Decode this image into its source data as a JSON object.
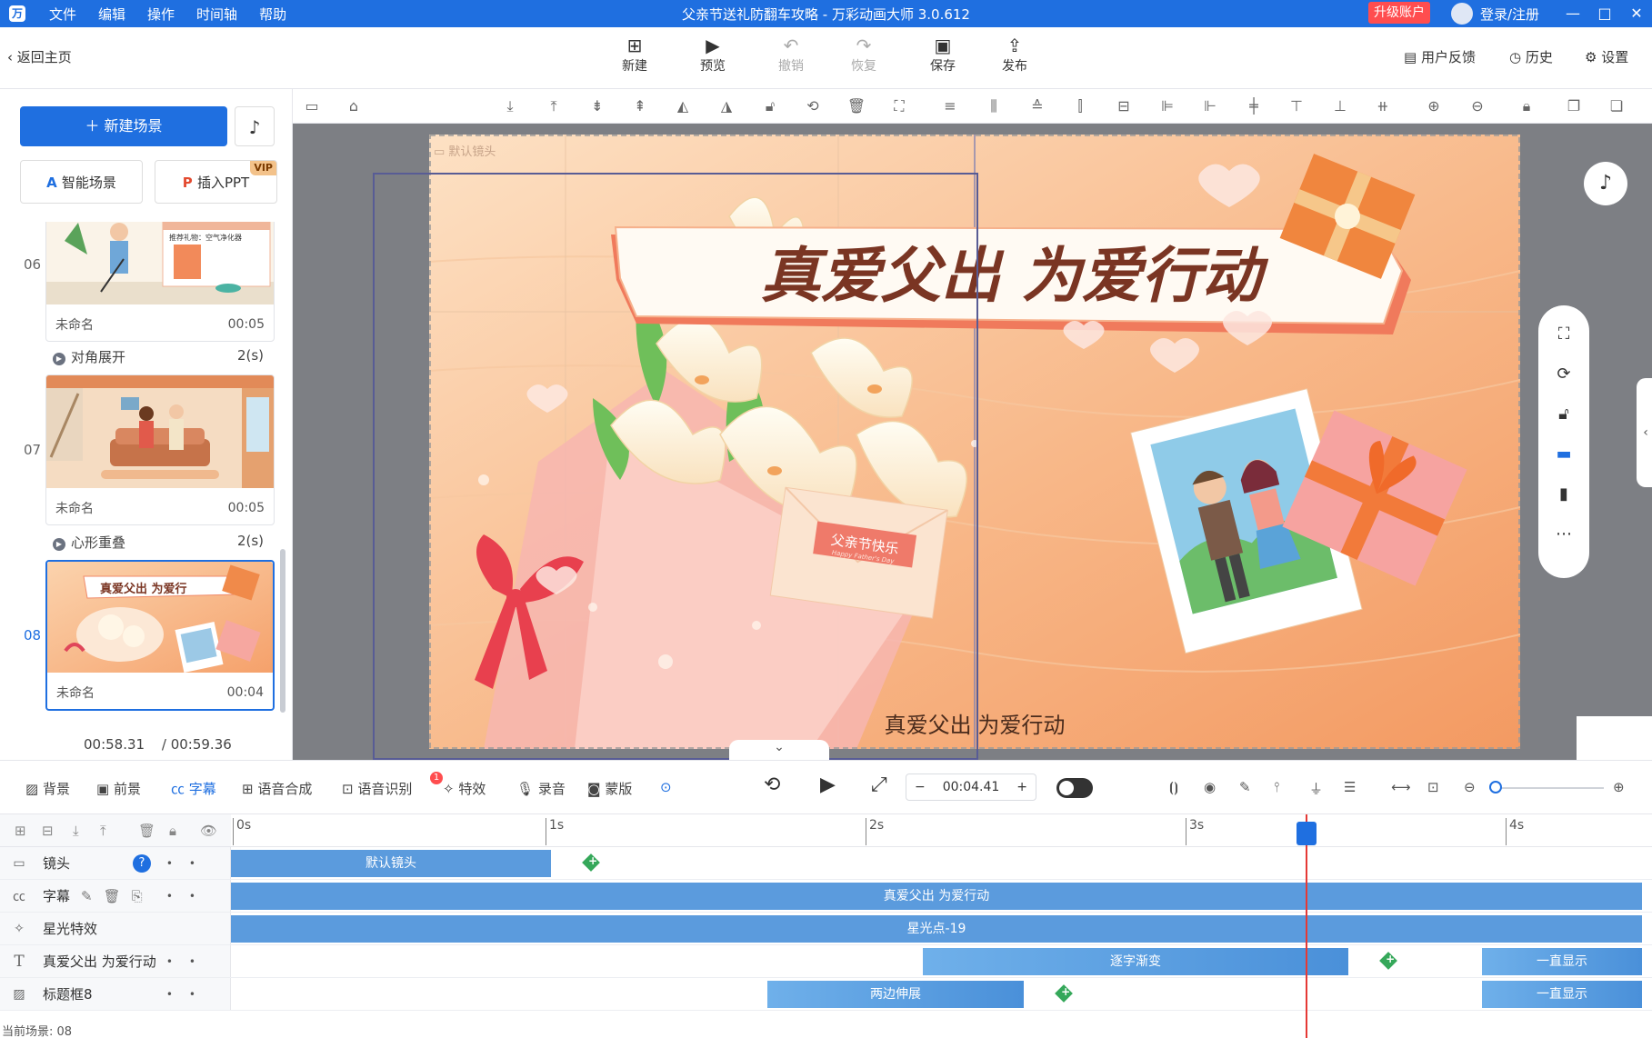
{
  "window": {
    "title": "父亲节送礼防翻车攻略 - 万彩动画大师 3.0.612",
    "menu": [
      "文件",
      "编辑",
      "操作",
      "时间轴",
      "帮助"
    ],
    "upgrade": "升级账户",
    "login": "登录/注册"
  },
  "toolbar": {
    "back": "返回主页",
    "new": "新建",
    "preview": "预览",
    "undo": "撤销",
    "redo": "恢复",
    "save": "保存",
    "publish": "发布",
    "feedback": "用户反馈",
    "history": "历史",
    "settings": "设置"
  },
  "left": {
    "new_scene": "新建场景",
    "smart_scene": "智能场景",
    "insert_ppt": "插入PPT",
    "vip": "VIP",
    "scenes": [
      {
        "no": "06",
        "name": "未命名",
        "dur": "00:05"
      },
      {
        "no": "07",
        "name": "未命名",
        "dur": "00:05"
      },
      {
        "no": "08",
        "name": "未命名",
        "dur": "00:04"
      }
    ],
    "transitions": [
      {
        "name": "对角展开",
        "dur": "2(s)"
      },
      {
        "name": "心形重叠",
        "dur": "2(s)"
      }
    ],
    "thumb_text": "真爱父出 为爱行",
    "thumb06_text": "推荐礼物：空气净化器",
    "time_current": "00:58.31",
    "time_total": "/ 00:59.36"
  },
  "canvas": {
    "camera_label": "默认镜头",
    "headline": "真爱父出  为爱行动",
    "subtitle": "真爱父出 为爱行动",
    "envelope": "父亲节快乐",
    "envelope_en": "Happy Father's Day"
  },
  "tl_toolbar": {
    "items": [
      "背景",
      "前景",
      "字幕",
      "语音合成",
      "语音识别",
      "特效",
      "录音",
      "蒙版"
    ],
    "badge": "1",
    "time": "00:04.41",
    "minus": "−",
    "plus": "+"
  },
  "timeline": {
    "ticks": [
      "0s",
      "1s",
      "2s",
      "3s",
      "4s"
    ],
    "rows": [
      {
        "label": "镜头",
        "clips": [
          {
            "text": "默认镜头"
          }
        ]
      },
      {
        "label": "字幕",
        "clips": [
          {
            "text": "真爱父出 为爱行动"
          }
        ]
      },
      {
        "label": "星光特效",
        "clips": [
          {
            "text": "星光点-19"
          }
        ]
      },
      {
        "label": "真爱父出 为爱行动",
        "clips": [
          {
            "text": "逐字渐变"
          },
          {
            "text": "一直显示"
          }
        ]
      },
      {
        "label": "标题框8",
        "clips": [
          {
            "text": "两边伸展"
          },
          {
            "text": "一直显示"
          }
        ]
      }
    ],
    "status": "当前场景: 08"
  },
  "colors": {
    "accent": "#1f6fe0",
    "clip": "#5b9bdd",
    "playhead": "#e53935",
    "canvas_bg": "#f6b27e"
  }
}
